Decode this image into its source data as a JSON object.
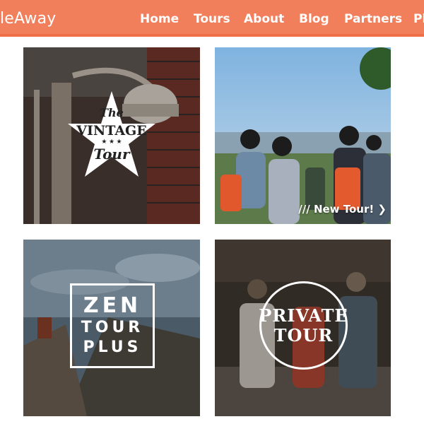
{
  "header": {
    "logo": "leAway",
    "nav": [
      "Home",
      "Tours",
      "About",
      "Blog",
      "Partners",
      "Ph"
    ]
  },
  "tiles": {
    "vintage": {
      "line1": "The",
      "line2": "VINTAGE",
      "line3": "Tour"
    },
    "new": {
      "caption": "/// New Tour! ❯"
    },
    "zen": {
      "line1": "ZEN",
      "line2": "TOUR",
      "line3": "PLUS"
    },
    "private": {
      "line1": "PRIVATE",
      "line2": "TOUR"
    }
  },
  "colors": {
    "header": "#f27f5b",
    "headerBorder": "#f06f49"
  }
}
